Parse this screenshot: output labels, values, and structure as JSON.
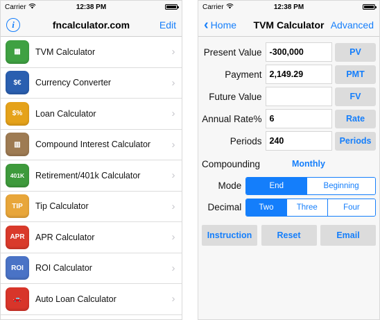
{
  "left_screen": {
    "status": {
      "carrier": "Carrier",
      "time": "12:38 PM"
    },
    "navbar": {
      "title": "fncalculator.com",
      "right": "Edit"
    },
    "items": [
      {
        "label": "TVM Calculator",
        "icon": "calculator-icon",
        "color": "#3fa142",
        "glyph": "▦"
      },
      {
        "label": "Currency Converter",
        "icon": "currency-icon",
        "color": "#2a5fb0",
        "glyph": "$€"
      },
      {
        "label": "Loan Calculator",
        "icon": "house-icon",
        "color": "#e5a21a",
        "glyph": "$%"
      },
      {
        "label": "Compound Interest Calculator",
        "icon": "bank-icon",
        "color": "#9e7b53",
        "glyph": "▥"
      },
      {
        "label": "Retirement/401k Calculator",
        "icon": "retirement-401k-icon",
        "color": "#3e9a3c",
        "glyph": "401K"
      },
      {
        "label": "Tip Calculator",
        "icon": "tip-icon",
        "color": "#e8a63a",
        "glyph": "TIP"
      },
      {
        "label": "APR Calculator",
        "icon": "apr-icon",
        "color": "#d93a2b",
        "glyph": "APR"
      },
      {
        "label": "ROI Calculator",
        "icon": "roi-icon",
        "color": "#4a73c6",
        "glyph": "ROI"
      },
      {
        "label": "Auto Loan Calculator",
        "icon": "car-icon",
        "color": "#d8352a",
        "glyph": "🚗"
      }
    ]
  },
  "right_screen": {
    "status": {
      "carrier": "Carrier",
      "time": "12:38 PM"
    },
    "navbar": {
      "back": "Home",
      "title": "TVM Calculator",
      "right": "Advanced"
    },
    "fields": [
      {
        "label": "Present Value",
        "value": "-300,000",
        "button": "PV"
      },
      {
        "label": "Payment",
        "value": "2,149.29",
        "button": "PMT"
      },
      {
        "label": "Future Value",
        "value": "",
        "button": "FV"
      },
      {
        "label": "Annual Rate%",
        "value": "6",
        "button": "Rate"
      },
      {
        "label": "Periods",
        "value": "240",
        "button": "Periods"
      }
    ],
    "compounding": {
      "label": "Compounding",
      "value": "Monthly"
    },
    "mode": {
      "label": "Mode",
      "options": [
        "End",
        "Beginning"
      ],
      "selected": "End"
    },
    "decimal": {
      "label": "Decimal",
      "options": [
        "Two",
        "Three",
        "Four"
      ],
      "selected": "Two"
    },
    "actions": [
      "Instruction",
      "Reset",
      "Email"
    ]
  },
  "colors": {
    "accent": "#147efb",
    "button_bg": "#dcdcdc"
  }
}
